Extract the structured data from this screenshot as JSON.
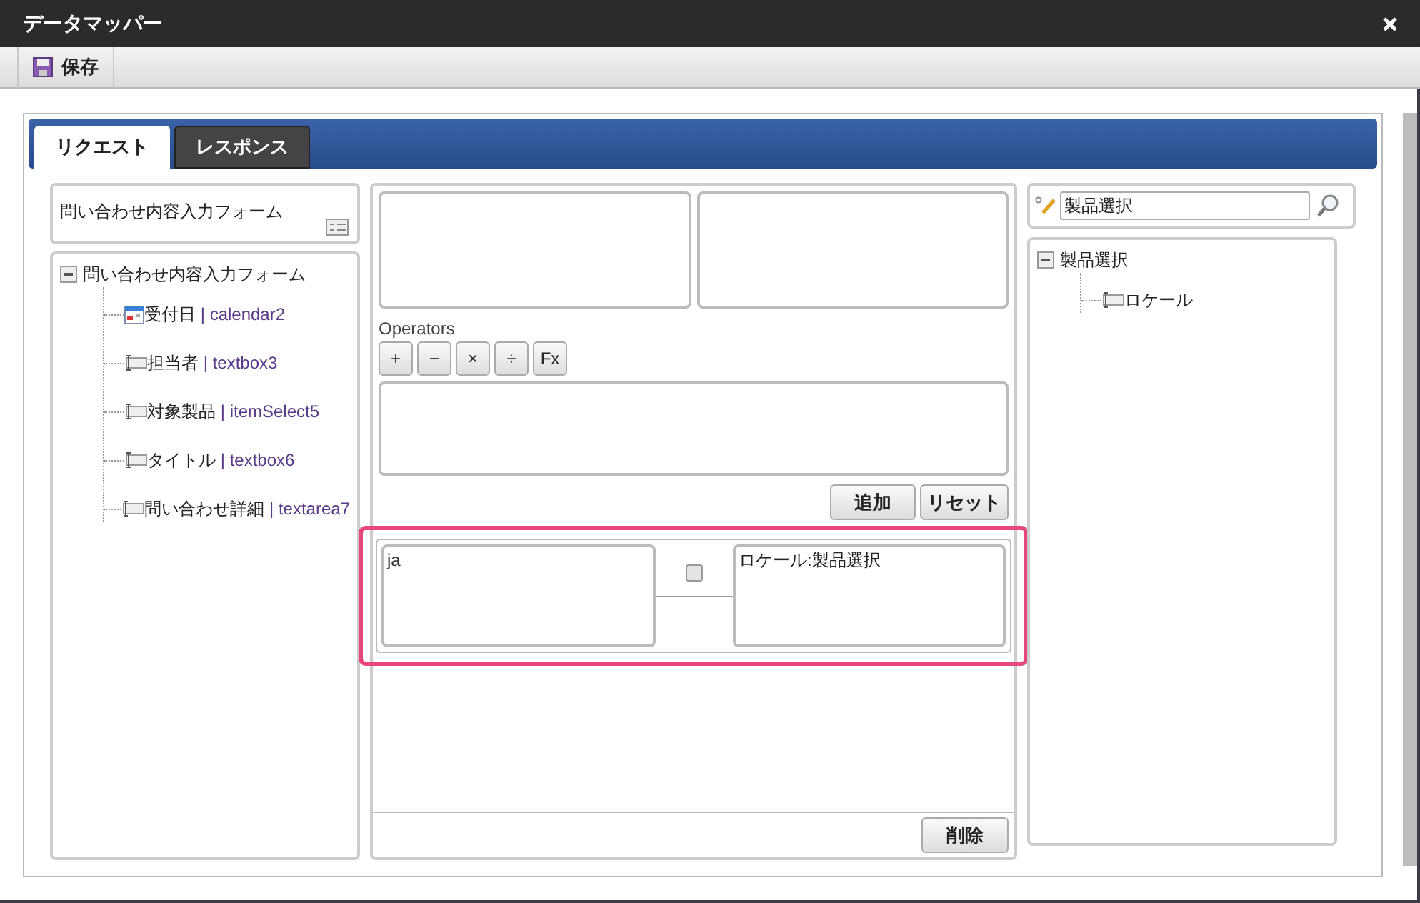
{
  "window": {
    "title": "データマッパー"
  },
  "toolbar": {
    "save_label": "保存"
  },
  "tabs": [
    {
      "label": "リクエスト",
      "selected": true
    },
    {
      "label": "レスポンス",
      "selected": false
    }
  ],
  "left_panel": {
    "form_title": "問い合わせ内容入力フォーム",
    "tree": {
      "label": "問い合わせ内容入力フォーム",
      "expanded": true,
      "children": [
        {
          "kind": "calendar",
          "label": "受付日",
          "separator": "|",
          "id_text": "calendar2"
        },
        {
          "kind": "textbox",
          "label": "担当者",
          "separator": "|",
          "id_text": "textbox3"
        },
        {
          "kind": "textbox",
          "label": "対象製品",
          "separator": "|",
          "id_text": "itemSelect5"
        },
        {
          "kind": "textbox",
          "label": "タイトル",
          "separator": "|",
          "id_text": "textbox6"
        },
        {
          "kind": "textbox",
          "label": "問い合わせ詳細",
          "separator": "|",
          "id_text": "textarea7"
        }
      ]
    }
  },
  "editor": {
    "operators_label": "Operators",
    "operators": [
      "+",
      "−",
      "×",
      "÷",
      "Fx"
    ],
    "add_button": "追加",
    "reset_button": "リセット"
  },
  "mappings": [
    {
      "source": "ja",
      "target": "ロケール:製品選択",
      "checked": false
    }
  ],
  "delete_button": "削除",
  "right_panel": {
    "search_value": "製品選択",
    "tree": {
      "label": "製品選択",
      "expanded": true,
      "children": [
        {
          "kind": "textbox",
          "label": "ロケール"
        }
      ]
    }
  }
}
